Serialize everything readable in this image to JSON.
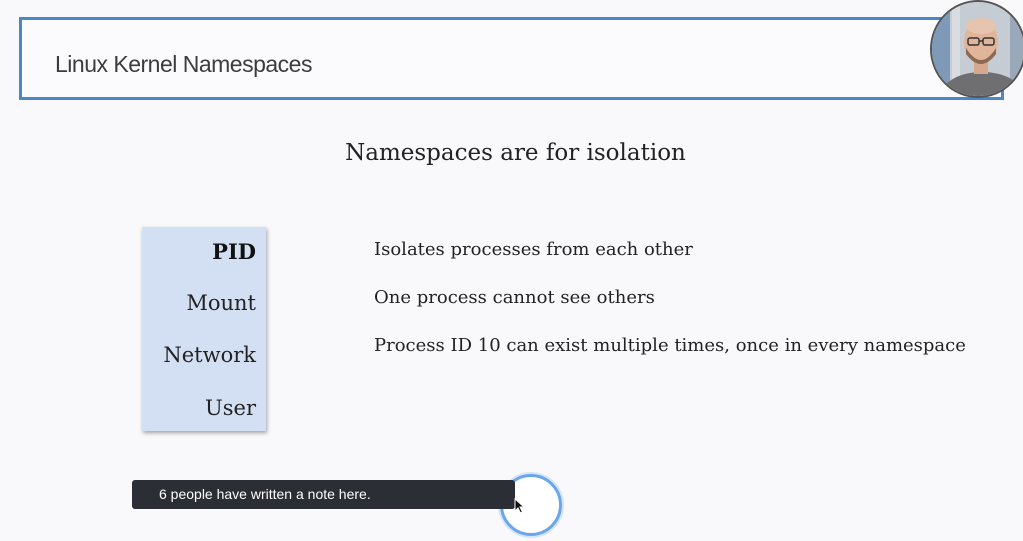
{
  "header": {
    "title": "Linux Kernel Namespaces"
  },
  "slide": {
    "subtitle": "Namespaces are for isolation",
    "namespaces": [
      "PID",
      "Mount",
      "Network",
      "User"
    ],
    "active_namespace": "PID",
    "descriptions": [
      "Isolates processes from each other",
      "One process cannot see others",
      "Process ID 10 can exist multiple times, once in every namespace"
    ]
  },
  "tooltip": {
    "text": "6 people have written a note here."
  },
  "colors": {
    "header_border": "#4a86c8",
    "panel_bg": "#d3e0f4",
    "tooltip_bg": "#2b2e35",
    "ring": "#6aa6ec"
  },
  "icons": {
    "webcam": "presenter-webcam-icon",
    "note_marker": "note-marker-icon",
    "cursor": "cursor-icon"
  }
}
